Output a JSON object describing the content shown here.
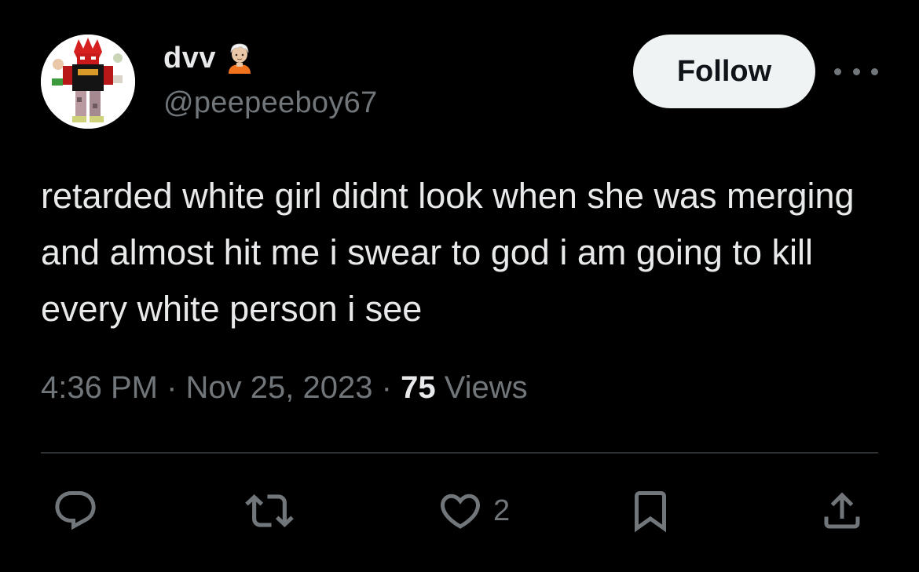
{
  "author": {
    "display_name": "dvv",
    "handle": "@peepeeboy67",
    "name_emoji": "person-with-white-hair-emoji",
    "avatar": "avatar-image"
  },
  "header": {
    "follow_label": "Follow",
    "more_icon": "more-horizontal-icon"
  },
  "tweet": {
    "text": "retarded white girl didnt look when she was merging and almost hit me i swear to god i am going to kill every white person i see",
    "time": "4:36 PM",
    "separator": "·",
    "date": "Nov 25, 2023",
    "views_count": "75",
    "views_label": "Views"
  },
  "actions": {
    "reply_icon": "reply-icon",
    "retweet_icon": "retweet-icon",
    "like_icon": "heart-icon",
    "like_count": "2",
    "bookmark_icon": "bookmark-icon",
    "share_icon": "share-icon"
  },
  "colors": {
    "background": "#000000",
    "primary_text": "#e7e9ea",
    "secondary_text": "#71767b",
    "divider": "#2f3336",
    "follow_button_bg": "#eff3f4",
    "follow_button_text": "#0f1419"
  }
}
